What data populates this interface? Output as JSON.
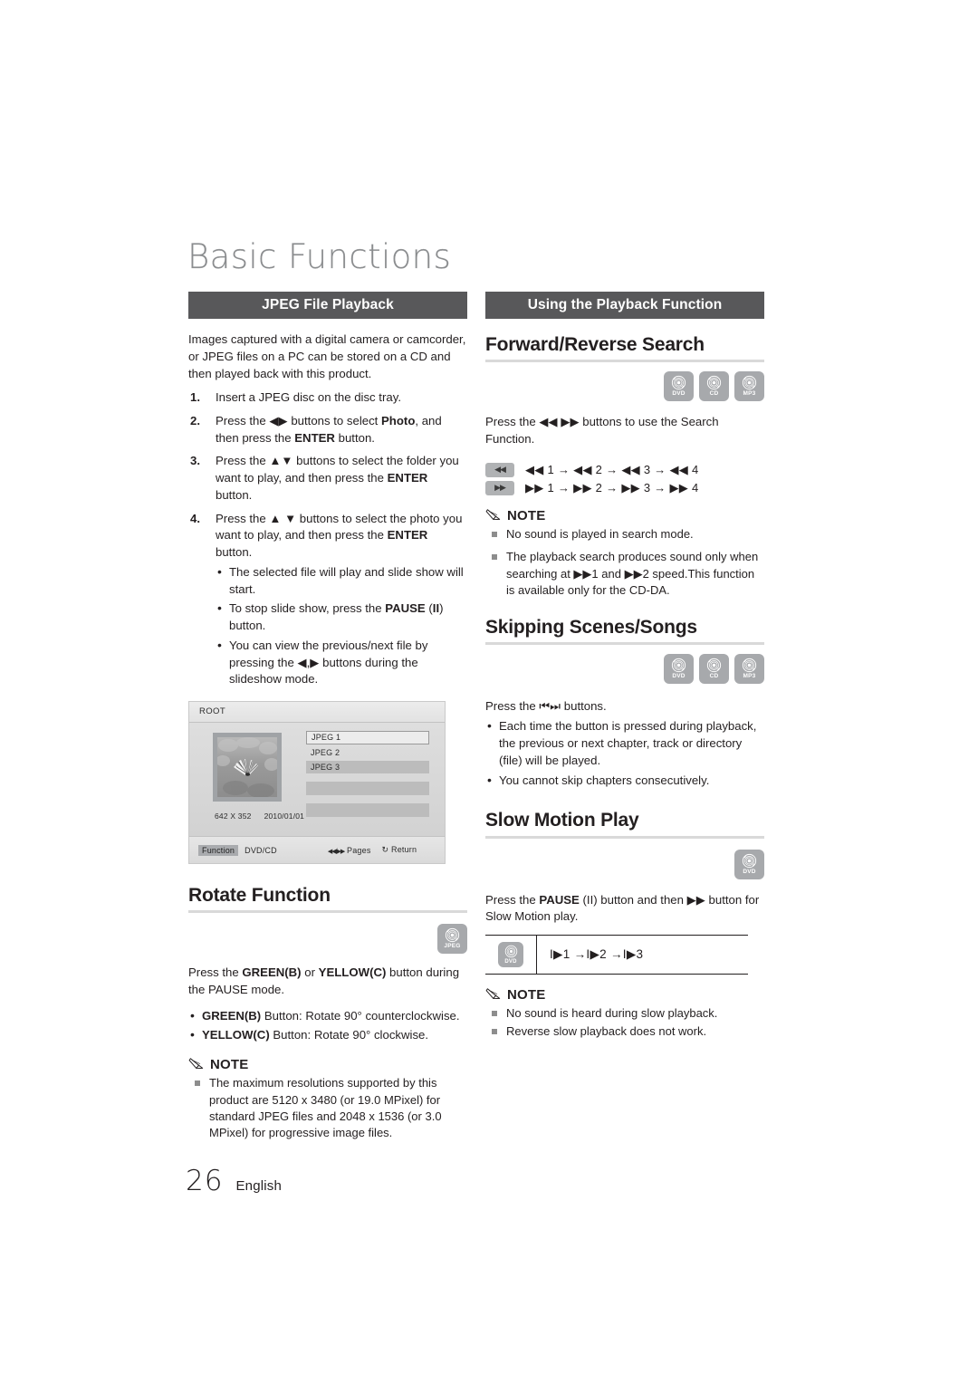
{
  "chapter": {
    "title": "Basic Functions"
  },
  "footer": {
    "page_number": "26",
    "language": "English"
  },
  "left": {
    "section_bar": "JPEG File Playback",
    "intro": "Images captured with a digital camera or camcorder, or JPEG files on a PC can be stored on a CD and then played back with this product.",
    "steps": [
      {
        "num": "1.",
        "text_parts": [
          "Insert a JPEG disc on the disc tray."
        ]
      },
      {
        "num": "2.",
        "text_html": "Press the ◀▶ buttons to select <b>Photo</b>, and then press the <b>ENTER</b> button."
      },
      {
        "num": "3.",
        "text_html": "Press the ▲▼ buttons to select the folder you want to play, and then press the <b>ENTER</b> button."
      },
      {
        "num": "4.",
        "text_html": "Press the ▲ ▼ buttons to select the photo you want to play, and then press the <b>ENTER</b> button."
      }
    ],
    "substeps": [
      "The selected file will play and slide show will start.",
      "To stop slide show, press the PAUSE (II) button.",
      "You can view the previous/next file by pressing the ◀,▶ buttons during the slideshow mode."
    ],
    "osd": {
      "title": "ROOT",
      "files": [
        "JPEG 1",
        "JPEG 2",
        "JPEG 3"
      ],
      "resolution": "642 X 352",
      "date": "2010/01/01",
      "footer_function": "Function",
      "footer_source": "DVD/CD",
      "footer_pages": "Pages",
      "footer_return": "Return"
    },
    "rotate": {
      "heading": "Rotate Function",
      "badges": [
        {
          "label": "JPEG"
        }
      ],
      "intro_html": "Press the <b>GREEN(B)</b> or <b>YELLOW(C)</b> button during the PAUSE mode.",
      "bullets_html": [
        "<b>GREEN(B)</b> Button: Rotate 90° counterclockwise.",
        "<b>YELLOW(C)</b> Button: Rotate 90° clockwise."
      ],
      "note_label": "NOTE",
      "notes": [
        "The maximum resolutions supported by this product are 5120 x 3480 (or 19.0 MPixel) for standard JPEG files and 2048 x 1536 (or 3.0 MPixel) for progressive image files."
      ]
    }
  },
  "right": {
    "section_bar": "Using the Playback Function",
    "search": {
      "heading": "Forward/Reverse Search",
      "badges": [
        {
          "label": "DVD"
        },
        {
          "label": "CD"
        },
        {
          "label": "MP3"
        }
      ],
      "intro": "Press the ◀◀ ▶▶ buttons to use the Search Function.",
      "speed_rows": [
        {
          "key": "◀◀",
          "sequence": "◀◀ 1 → ◀◀ 2 → ◀◀ 3 → ◀◀ 4"
        },
        {
          "key": "▶▶",
          "sequence": "▶▶ 1 → ▶▶ 2 → ▶▶ 3 → ▶▶ 4"
        }
      ],
      "note_label": "NOTE",
      "notes": [
        "No sound is played in search mode.",
        "The playback search produces sound only when searching at ▶▶1 and ▶▶2 speed.This function is available only for the CD-DA."
      ]
    },
    "skipping": {
      "heading": "Skipping Scenes/Songs",
      "badges": [
        {
          "label": "DVD"
        },
        {
          "label": "CD"
        },
        {
          "label": "MP3"
        }
      ],
      "intro": "Press the ⏮⏭ buttons.",
      "bullets": [
        "Each time the button is pressed during playback, the previous or next chapter, track or directory (file) will be played.",
        "You cannot skip chapters consecutively."
      ]
    },
    "slow": {
      "heading": "Slow Motion Play",
      "badges": [
        {
          "label": "DVD"
        }
      ],
      "intro_html": "Press the <b>PAUSE</b> (II) button and then ▶▶ button for Slow Motion play.",
      "table_badge_label": "DVD",
      "table_sequence": "I▶1 →I▶2 →I▶3",
      "note_label": "NOTE",
      "notes": [
        "No sound is heard during slow playback.",
        "Reverse slow playback does not work."
      ]
    }
  }
}
